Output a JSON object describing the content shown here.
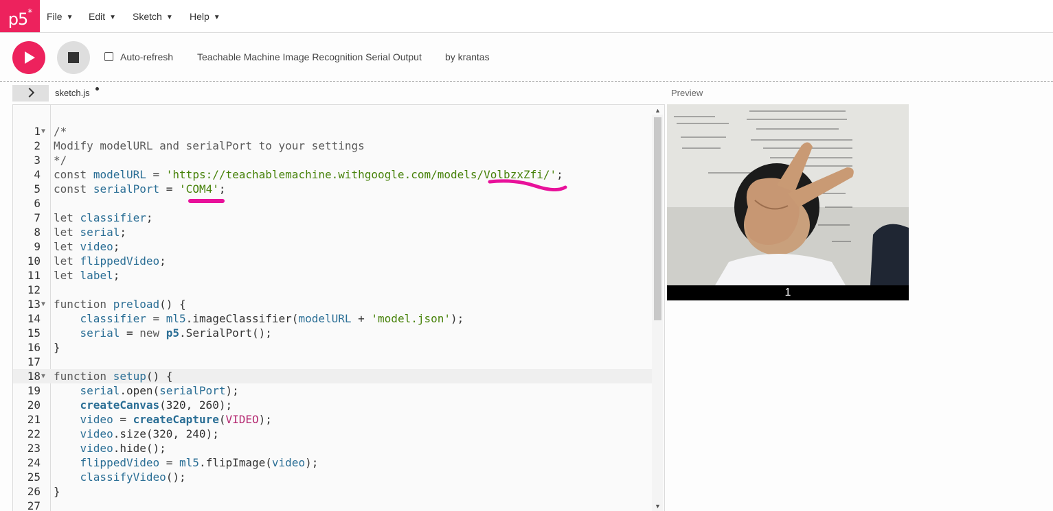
{
  "nav": {
    "logo": "p5",
    "logo_mark": "*",
    "menus": [
      "File",
      "Edit",
      "Sketch",
      "Help"
    ]
  },
  "toolbar": {
    "auto_refresh_label": "Auto-refresh",
    "auto_refresh_checked": false,
    "sketch_title": "Teachable Machine Image Recognition Serial Output",
    "author": "by krantas"
  },
  "editor": {
    "file_name": "sketch.js",
    "unsaved": true,
    "active_line": 18,
    "folded_lines": [
      1,
      13,
      18
    ],
    "line_numbers": [
      "1",
      "2",
      "3",
      "4",
      "5",
      "6",
      "7",
      "8",
      "9",
      "10",
      "11",
      "12",
      "13",
      "14",
      "15",
      "16",
      "17",
      "18",
      "19",
      "20",
      "21",
      "22",
      "23",
      "24",
      "25",
      "26",
      "27"
    ],
    "lines": [
      "/*",
      "Modify modelURL and serialPort to your settings",
      "*/",
      "const modelURL = 'https://teachablemachine.withgoogle.com/models/VolbzxZfi/';",
      "const serialPort = 'COM4';",
      "",
      "let classifier;",
      "let serial;",
      "let video;",
      "let flippedVideo;",
      "let label;",
      "",
      "function preload() {",
      "    classifier = ml5.imageClassifier(modelURL + 'model.json');",
      "    serial = new p5.SerialPort();",
      "}",
      "",
      "function setup() {",
      "    serial.open(serialPort);",
      "    createCanvas(320, 260);",
      "    video = createCapture(VIDEO);",
      "    video.size(320, 240);",
      "    video.hide();",
      "    flippedVideo = ml5.flipImage(video);",
      "    classifyVideo();",
      "}",
      ""
    ]
  },
  "preview": {
    "label": "Preview",
    "output_label": "1"
  },
  "colors": {
    "accent": "#ed225d",
    "annotation_marker": "#e8119a"
  }
}
